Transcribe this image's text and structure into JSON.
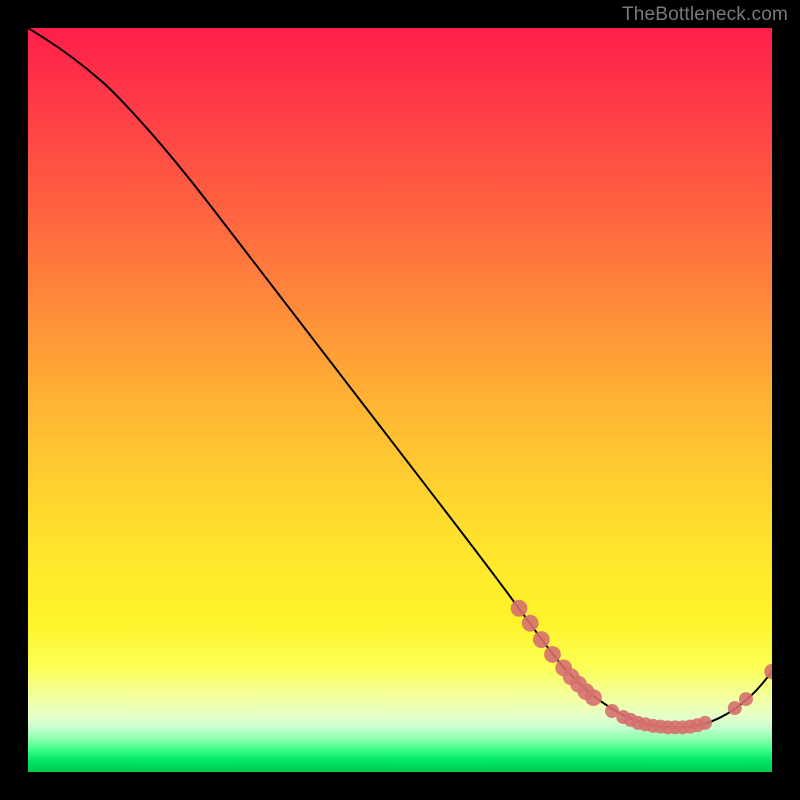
{
  "attribution": "TheBottleneck.com",
  "chart_data": {
    "type": "line",
    "title": "",
    "xlabel": "",
    "ylabel": "",
    "xlim": [
      0,
      100
    ],
    "ylim": [
      0,
      100
    ],
    "grid": false,
    "legend": false,
    "series": [
      {
        "name": "curve",
        "x": [
          0,
          4,
          8,
          12,
          20,
          30,
          40,
          50,
          60,
          66,
          70,
          72,
          74,
          76,
          78,
          80,
          82,
          84,
          86,
          88,
          90,
          92,
          94,
          96,
          98,
          100
        ],
        "y": [
          100,
          97.5,
          94.5,
          91,
          82,
          69,
          56,
          43,
          30,
          22,
          16.5,
          14,
          12,
          10.2,
          8.8,
          7.6,
          6.8,
          6.2,
          6,
          6,
          6.2,
          6.8,
          7.8,
          9.2,
          11,
          13.5
        ]
      }
    ],
    "markers": [
      {
        "x": 66.0,
        "y": 22.0,
        "r": 1.2
      },
      {
        "x": 67.5,
        "y": 20.0,
        "r": 1.2
      },
      {
        "x": 69.0,
        "y": 17.8,
        "r": 1.2
      },
      {
        "x": 70.5,
        "y": 15.8,
        "r": 1.2
      },
      {
        "x": 72.0,
        "y": 14.0,
        "r": 1.2
      },
      {
        "x": 73.0,
        "y": 12.8,
        "r": 1.2
      },
      {
        "x": 74.0,
        "y": 11.8,
        "r": 1.2
      },
      {
        "x": 75.0,
        "y": 10.8,
        "r": 1.2
      },
      {
        "x": 76.0,
        "y": 10.0,
        "r": 1.2
      },
      {
        "x": 78.5,
        "y": 8.2,
        "r": 1.0
      },
      {
        "x": 80.0,
        "y": 7.4,
        "r": 1.0
      },
      {
        "x": 81.0,
        "y": 7.0,
        "r": 1.0
      },
      {
        "x": 82.0,
        "y": 6.6,
        "r": 1.0
      },
      {
        "x": 83.0,
        "y": 6.4,
        "r": 1.0
      },
      {
        "x": 84.0,
        "y": 6.2,
        "r": 1.0
      },
      {
        "x": 85.0,
        "y": 6.1,
        "r": 1.0
      },
      {
        "x": 86.0,
        "y": 6.0,
        "r": 1.0
      },
      {
        "x": 87.0,
        "y": 6.0,
        "r": 1.0
      },
      {
        "x": 88.0,
        "y": 6.0,
        "r": 1.0
      },
      {
        "x": 89.0,
        "y": 6.1,
        "r": 1.0
      },
      {
        "x": 90.0,
        "y": 6.3,
        "r": 1.0
      },
      {
        "x": 91.0,
        "y": 6.6,
        "r": 1.0
      },
      {
        "x": 95.0,
        "y": 8.6,
        "r": 1.0
      },
      {
        "x": 96.5,
        "y": 9.8,
        "r": 1.0
      },
      {
        "x": 100.0,
        "y": 13.5,
        "r": 1.1
      }
    ],
    "colors": {
      "line": "#000000",
      "marker": "#d6706f"
    }
  }
}
